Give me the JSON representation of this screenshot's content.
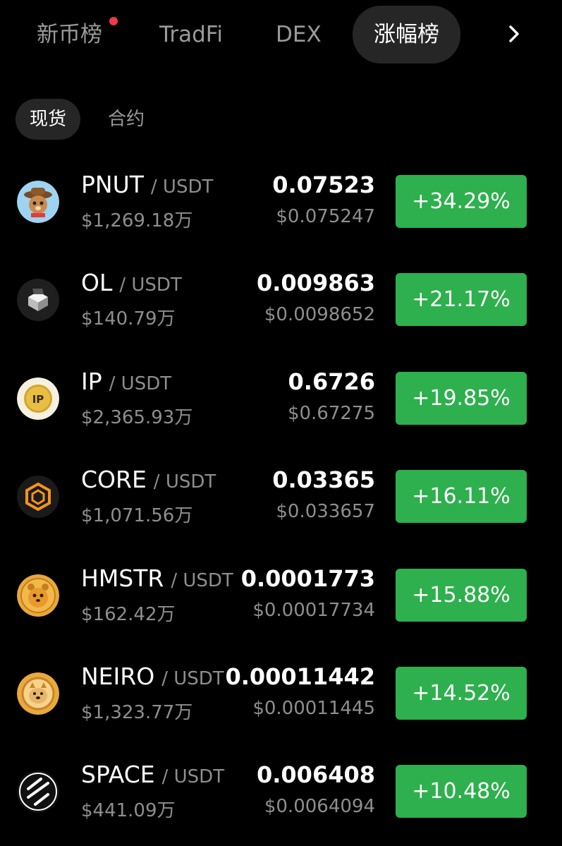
{
  "top_tabs": [
    {
      "label": "新币榜",
      "has_dot": true
    },
    {
      "label": "TradFi"
    },
    {
      "label": "DEX"
    },
    {
      "label": "涨幅榜",
      "active": true
    }
  ],
  "more_icon": "chevron-right-icon",
  "sub_tabs": [
    {
      "label": "现货",
      "active": true
    },
    {
      "label": "合约"
    }
  ],
  "rows": [
    {
      "base": "PNUT",
      "quote": "/ USDT",
      "volume": "$1,269.18万",
      "price": "0.07523",
      "usd_price": "$0.075247",
      "change": "+34.29%",
      "icon": "pnut-squirrel-icon"
    },
    {
      "base": "OL",
      "quote": "/ USDT",
      "volume": "$140.79万",
      "price": "0.009863",
      "usd_price": "$0.0098652",
      "change": "+21.17%",
      "icon": "ol-cube-icon"
    },
    {
      "base": "IP",
      "quote": "/ USDT",
      "volume": "$2,365.93万",
      "price": "0.6726",
      "usd_price": "$0.67275",
      "change": "+19.85%",
      "icon": "ip-gold-icon"
    },
    {
      "base": "CORE",
      "quote": "/ USDT",
      "volume": "$1,071.56万",
      "price": "0.03365",
      "usd_price": "$0.033657",
      "change": "+16.11%",
      "icon": "core-hexagon-icon"
    },
    {
      "base": "HMSTR",
      "quote": "/ USDT",
      "volume": "$162.42万",
      "price": "0.0001773",
      "usd_price": "$0.00017734",
      "change": "+15.88%",
      "icon": "hmstr-hamster-icon"
    },
    {
      "base": "NEIRO",
      "quote": "/ USDT",
      "volume": "$1,323.77万",
      "price": "0.00011442",
      "usd_price": "$0.00011445",
      "change": "+14.52%",
      "icon": "neiro-dog-icon"
    },
    {
      "base": "SPACE",
      "quote": "/ USDT",
      "volume": "$441.09万",
      "price": "0.006408",
      "usd_price": "$0.0064094",
      "change": "+10.48%",
      "icon": "space-stripes-icon"
    }
  ],
  "colors": {
    "positive": "#2db04d",
    "accent_dot": "#f0394d",
    "background": "#000000"
  }
}
